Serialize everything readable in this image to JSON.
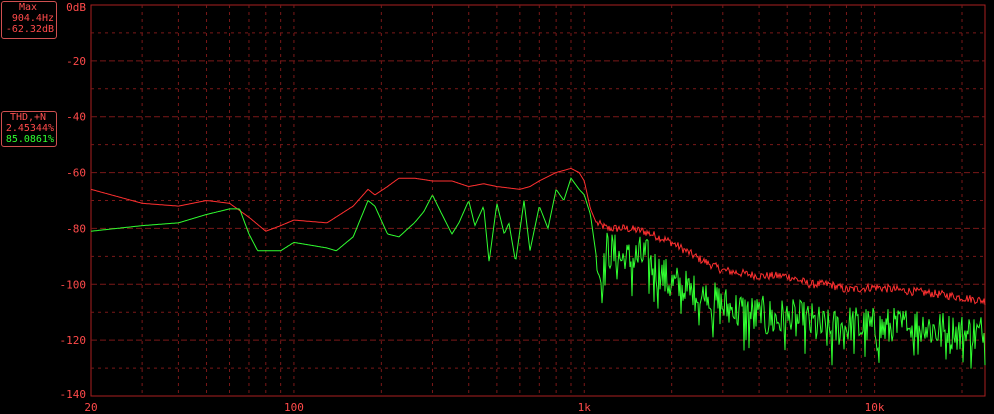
{
  "max_box": {
    "title": "Max",
    "freq": "904.4Hz",
    "level": "-62.32dB"
  },
  "thd_box": {
    "title": "THD,+N",
    "red_value": "2.45344%",
    "green_value": "85.0861%"
  },
  "colors": {
    "red_trace": "#ff3030",
    "green_trace": "#30ff30",
    "grid": "#7a1818",
    "text": "#ff4a4a"
  },
  "chart_data": {
    "type": "line",
    "xscale": "log",
    "xlim": [
      20,
      24000
    ],
    "ylim": [
      -140,
      0
    ],
    "grid": true,
    "y_ticks": [
      {
        "v": 0,
        "label": "0dB"
      },
      {
        "v": -20,
        "label": "-20"
      },
      {
        "v": -40,
        "label": "-40"
      },
      {
        "v": -60,
        "label": "-60"
      },
      {
        "v": -80,
        "label": "-80"
      },
      {
        "v": -100,
        "label": "-100"
      },
      {
        "v": -120,
        "label": "-120"
      },
      {
        "v": -140,
        "label": "-140"
      }
    ],
    "x_ticks": [
      {
        "v": 20,
        "label": "20"
      },
      {
        "v": 100,
        "label": "100"
      },
      {
        "v": 1000,
        "label": "1k"
      },
      {
        "v": 10000,
        "label": "10k"
      }
    ],
    "series": [
      {
        "color": "#ff3030",
        "points": [
          [
            20,
            -66
          ],
          [
            30,
            -71
          ],
          [
            40,
            -72
          ],
          [
            50,
            -70
          ],
          [
            60,
            -71
          ],
          [
            70,
            -76
          ],
          [
            80,
            -81
          ],
          [
            90,
            -79
          ],
          [
            100,
            -77
          ],
          [
            130,
            -78
          ],
          [
            160,
            -72
          ],
          [
            180,
            -66
          ],
          [
            190,
            -68
          ],
          [
            210,
            -65
          ],
          [
            230,
            -62
          ],
          [
            260,
            -62
          ],
          [
            300,
            -63
          ],
          [
            350,
            -63
          ],
          [
            400,
            -65
          ],
          [
            450,
            -64
          ],
          [
            500,
            -65
          ],
          [
            600,
            -66
          ],
          [
            650,
            -65
          ],
          [
            700,
            -63
          ],
          [
            800,
            -60
          ],
          [
            900,
            -58.5
          ],
          [
            960,
            -60
          ],
          [
            1000,
            -63
          ],
          [
            1050,
            -73
          ],
          [
            1100,
            -78
          ],
          [
            1200,
            -80
          ],
          [
            1400,
            -80
          ],
          [
            1600,
            -81
          ],
          [
            1800,
            -83
          ],
          [
            2000,
            -85
          ],
          [
            2500,
            -91
          ],
          [
            3000,
            -95
          ],
          [
            4000,
            -97
          ],
          [
            5000,
            -97
          ],
          [
            6000,
            -100
          ],
          [
            7000,
            -100
          ],
          [
            8000,
            -102
          ],
          [
            10000,
            -101
          ],
          [
            12000,
            -102
          ],
          [
            15000,
            -103
          ],
          [
            18000,
            -104
          ],
          [
            24000,
            -106
          ]
        ]
      },
      {
        "color": "#30ff30",
        "points": [
          [
            20,
            -81
          ],
          [
            30,
            -79
          ],
          [
            40,
            -78
          ],
          [
            50,
            -75
          ],
          [
            60,
            -73
          ],
          [
            65,
            -73
          ],
          [
            70,
            -82
          ],
          [
            75,
            -88
          ],
          [
            90,
            -88
          ],
          [
            100,
            -85
          ],
          [
            130,
            -87
          ],
          [
            140,
            -88
          ],
          [
            160,
            -83
          ],
          [
            180,
            -70
          ],
          [
            190,
            -72
          ],
          [
            210,
            -82
          ],
          [
            230,
            -83
          ],
          [
            260,
            -78
          ],
          [
            280,
            -74
          ],
          [
            300,
            -68
          ],
          [
            320,
            -74
          ],
          [
            350,
            -82
          ],
          [
            370,
            -78
          ],
          [
            400,
            -70
          ],
          [
            420,
            -79
          ],
          [
            450,
            -72
          ],
          [
            470,
            -92
          ],
          [
            500,
            -71
          ],
          [
            530,
            -82
          ],
          [
            550,
            -78
          ],
          [
            580,
            -92
          ],
          [
            620,
            -70
          ],
          [
            650,
            -88
          ],
          [
            700,
            -72
          ],
          [
            750,
            -80
          ],
          [
            800,
            -66
          ],
          [
            850,
            -70
          ],
          [
            900,
            -62
          ],
          [
            960,
            -66
          ],
          [
            1000,
            -68
          ],
          [
            1050,
            -75
          ],
          [
            1100,
            -90
          ],
          [
            1150,
            -100
          ],
          [
            1200,
            -88
          ],
          [
            1400,
            -92
          ],
          [
            1600,
            -90
          ],
          [
            1800,
            -96
          ],
          [
            2000,
            -100
          ],
          [
            2500,
            -105
          ],
          [
            3000,
            -108
          ],
          [
            4000,
            -112
          ],
          [
            5000,
            -113
          ],
          [
            6000,
            -114
          ],
          [
            7000,
            -117
          ],
          [
            8000,
            -115
          ],
          [
            10000,
            -116
          ],
          [
            12000,
            -116
          ],
          [
            15000,
            -115
          ],
          [
            18000,
            -118
          ],
          [
            24000,
            -118
          ]
        ]
      }
    ]
  }
}
